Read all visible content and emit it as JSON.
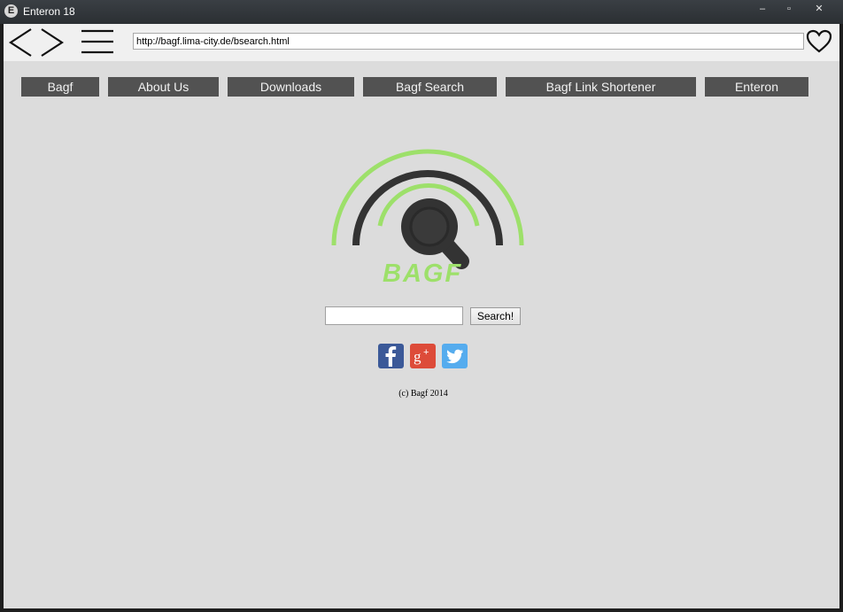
{
  "window": {
    "title": "Enteron 18",
    "app_icon_letter": "E",
    "min_glyph": "–",
    "max_glyph": "▫",
    "close_glyph": "✕"
  },
  "toolbar": {
    "url": "http://bagf.lima-city.de/bsearch.html"
  },
  "site_nav": {
    "items": [
      "Bagf",
      "About Us",
      "Downloads",
      "Bagf Search",
      "Bagf Link Shortener",
      "Enteron"
    ],
    "background": "#525252"
  },
  "logo": {
    "text": "BAGF",
    "colors": {
      "green": "#9de06a",
      "dark": "#333333"
    }
  },
  "search": {
    "value": "",
    "button_label": "Search!"
  },
  "social": [
    {
      "name": "facebook",
      "glyph": "f",
      "color": "#3b5998"
    },
    {
      "name": "google-plus",
      "glyph": "g+",
      "color": "#dd4b39"
    },
    {
      "name": "twitter",
      "glyph": "twitter-bird",
      "color": "#55acee"
    }
  ],
  "footer": {
    "copyright": "(c) Bagf 2014"
  }
}
